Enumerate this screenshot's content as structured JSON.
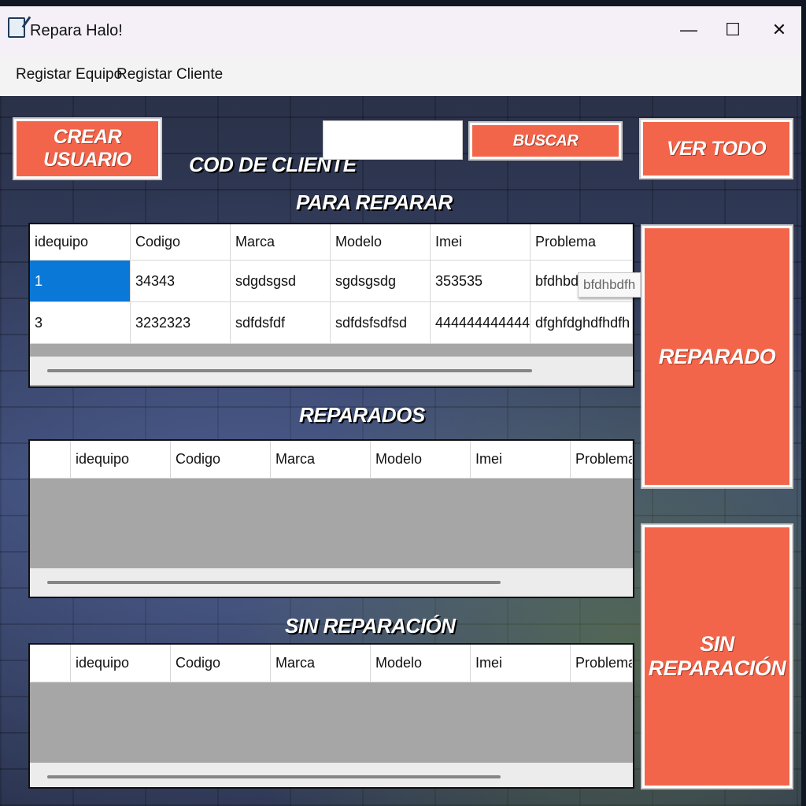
{
  "window": {
    "title": "Repara Halo!",
    "minimize": "—",
    "maximize": "☐",
    "close": "✕"
  },
  "menu": {
    "items": [
      "Registar Equipo",
      "Registar Cliente"
    ]
  },
  "buttons": {
    "crear_usuario": "CREAR USUARIO",
    "buscar": "BUSCAR",
    "ver_todo": "VER TODO",
    "reparado": "REPARADO",
    "sin_reparacion": "SIN REPARACIÓN"
  },
  "labels": {
    "cod_cliente": "COD DE CLIENTE",
    "para_reparar": "PARA REPARAR",
    "reparados": "REPARADOS",
    "sin_reparacion": "SIN REPARACIÓN"
  },
  "search": {
    "value": ""
  },
  "grid_para_reparar": {
    "columns": [
      "idequipo",
      "Codigo",
      "Marca",
      "Modelo",
      "Imei",
      "Problema"
    ],
    "rows": [
      [
        "1",
        "34343",
        "sdgdsgsd",
        "sgdsgsdg",
        "353535",
        "bfdhbdf"
      ],
      [
        "3",
        "3232323",
        "sdfdsfdf",
        "sdfdsfsdfsd",
        "444444444444",
        "dfghfdghdfhdfh"
      ]
    ],
    "tooltip": "bfdhbdfh"
  },
  "grid_reparados": {
    "columns": [
      "idequipo",
      "Codigo",
      "Marca",
      "Modelo",
      "Imei",
      "Problema"
    ]
  },
  "grid_sin_reparacion": {
    "columns": [
      "idequipo",
      "Codigo",
      "Marca",
      "Modelo",
      "Imei",
      "Problema"
    ]
  }
}
